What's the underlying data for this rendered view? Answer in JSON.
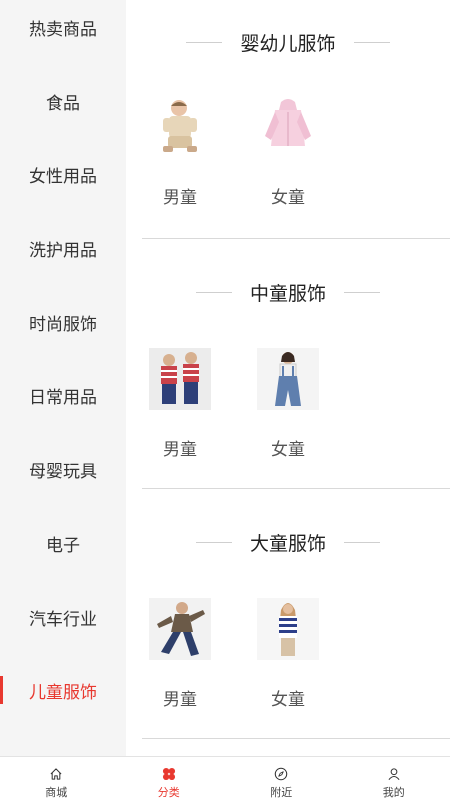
{
  "sidebar": {
    "active_index": 9,
    "items": [
      {
        "label": "热卖商品"
      },
      {
        "label": "食品"
      },
      {
        "label": "女性用品"
      },
      {
        "label": "洗护用品"
      },
      {
        "label": "时尚服饰"
      },
      {
        "label": "日常用品"
      },
      {
        "label": "母婴玩具"
      },
      {
        "label": "电子"
      },
      {
        "label": "汽车行业"
      },
      {
        "label": "儿童服饰"
      }
    ]
  },
  "sections": [
    {
      "title": "婴幼儿服饰",
      "tiles": [
        {
          "label": "男童",
          "image": "baby-boy-clothing"
        },
        {
          "label": "女童",
          "image": "baby-girl-jacket"
        }
      ]
    },
    {
      "title": "中童服饰",
      "tiles": [
        {
          "label": "男童",
          "image": "boys-striped-shirt"
        },
        {
          "label": "女童",
          "image": "girl-denim-overalls"
        }
      ]
    },
    {
      "title": "大童服饰",
      "tiles": [
        {
          "label": "男童",
          "image": "teen-boy-jacket"
        },
        {
          "label": "女童",
          "image": "teen-girl-striped-top"
        }
      ]
    }
  ],
  "tabbar": {
    "active_index": 1,
    "tabs": [
      {
        "label": "商城",
        "icon": "home-icon"
      },
      {
        "label": "分类",
        "icon": "category-icon"
      },
      {
        "label": "附近",
        "icon": "compass-icon"
      },
      {
        "label": "我的",
        "icon": "user-icon"
      }
    ]
  },
  "colors": {
    "accent": "#e8382f",
    "sidebar_bg": "#f5f5f5"
  }
}
